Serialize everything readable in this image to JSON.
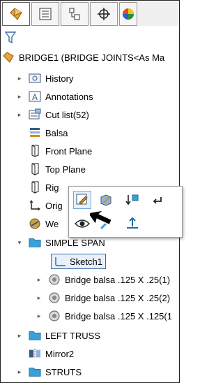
{
  "tabs": [
    {
      "icon": "feature-manager-icon",
      "active": true
    },
    {
      "icon": "property-manager-icon",
      "active": false
    },
    {
      "icon": "configuration-manager-icon",
      "active": false
    },
    {
      "icon": "dimxpert-manager-icon",
      "active": false
    },
    {
      "icon": "display-manager-icon",
      "active": false
    }
  ],
  "tree": {
    "root": "BRIDGE1  (BRIDGE JOINTS<As Ma",
    "history": "History",
    "annotations": "Annotations",
    "cutlist": "Cut list(52)",
    "material": "Balsa",
    "front_plane": "Front Plane",
    "top_plane": "Top Plane",
    "right_plane": "Rig",
    "origin": "Orig",
    "weldment": "We",
    "simple_span": "SIMPLE SPAN",
    "sketch1": "Sketch1",
    "body1": "Bridge balsa .125 X .25(1)",
    "body2": "Bridge balsa .125 X .25(2)",
    "body3": "Bridge balsa .125 X .125(1",
    "left_truss": "LEFT TRUSS",
    "mirror2": "Mirror2",
    "struts": "STRUTS"
  },
  "popup": {
    "buttons": [
      "edit-sketch-icon",
      "edit-feature-icon",
      "rollback-icon",
      "undo-arrow-icon",
      "show-icon",
      "sketch-tool-icon",
      "normal-to-icon"
    ]
  },
  "colors": {
    "selection": "#3a6ea5",
    "folder": "#3aa0d8",
    "accent": "#d98a1f"
  }
}
